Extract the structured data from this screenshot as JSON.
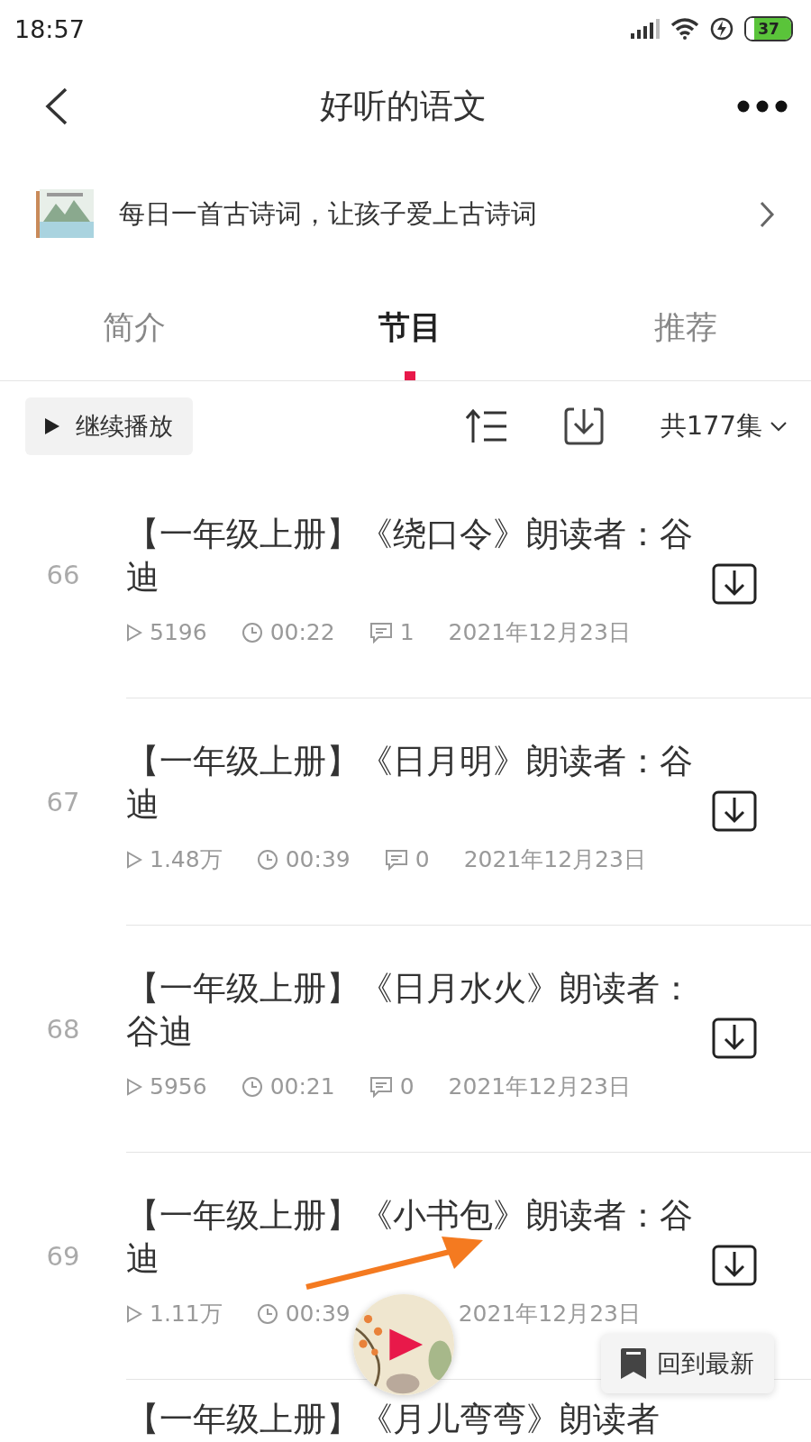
{
  "status_bar": {
    "time": "18:57",
    "battery": "37"
  },
  "header": {
    "title": "好听的语文"
  },
  "banner": {
    "text": "每日一首古诗词，让孩子爱上古诗词"
  },
  "tabs": [
    {
      "label": "简介",
      "selected": false
    },
    {
      "label": "节目",
      "selected": true
    },
    {
      "label": "推荐",
      "selected": false
    }
  ],
  "toolbar": {
    "continue_button": "继续播放",
    "episode_count": "共177集"
  },
  "episodes": [
    {
      "number": "66",
      "title": "【一年级上册】《绕口令》朗读者：谷迪",
      "plays": "5196",
      "duration": "00:22",
      "comments": "1",
      "date": "2021年12月23日"
    },
    {
      "number": "67",
      "title": "【一年级上册】《日月明》朗读者：谷迪",
      "plays": "1.48万",
      "duration": "00:39",
      "comments": "0",
      "date": "2021年12月23日"
    },
    {
      "number": "68",
      "title": "【一年级上册】《日月水火》朗读者：谷迪",
      "plays": "5956",
      "duration": "00:21",
      "comments": "0",
      "date": "2021年12月23日"
    },
    {
      "number": "69",
      "title": "【一年级上册】《小书包》朗读者：谷迪",
      "plays": "1.11万",
      "duration": "00:39",
      "date": "2021年12月23日"
    },
    {
      "title": "【一年级上册】《月儿弯弯》朗读者"
    }
  ],
  "back_to_latest": "回到最新"
}
